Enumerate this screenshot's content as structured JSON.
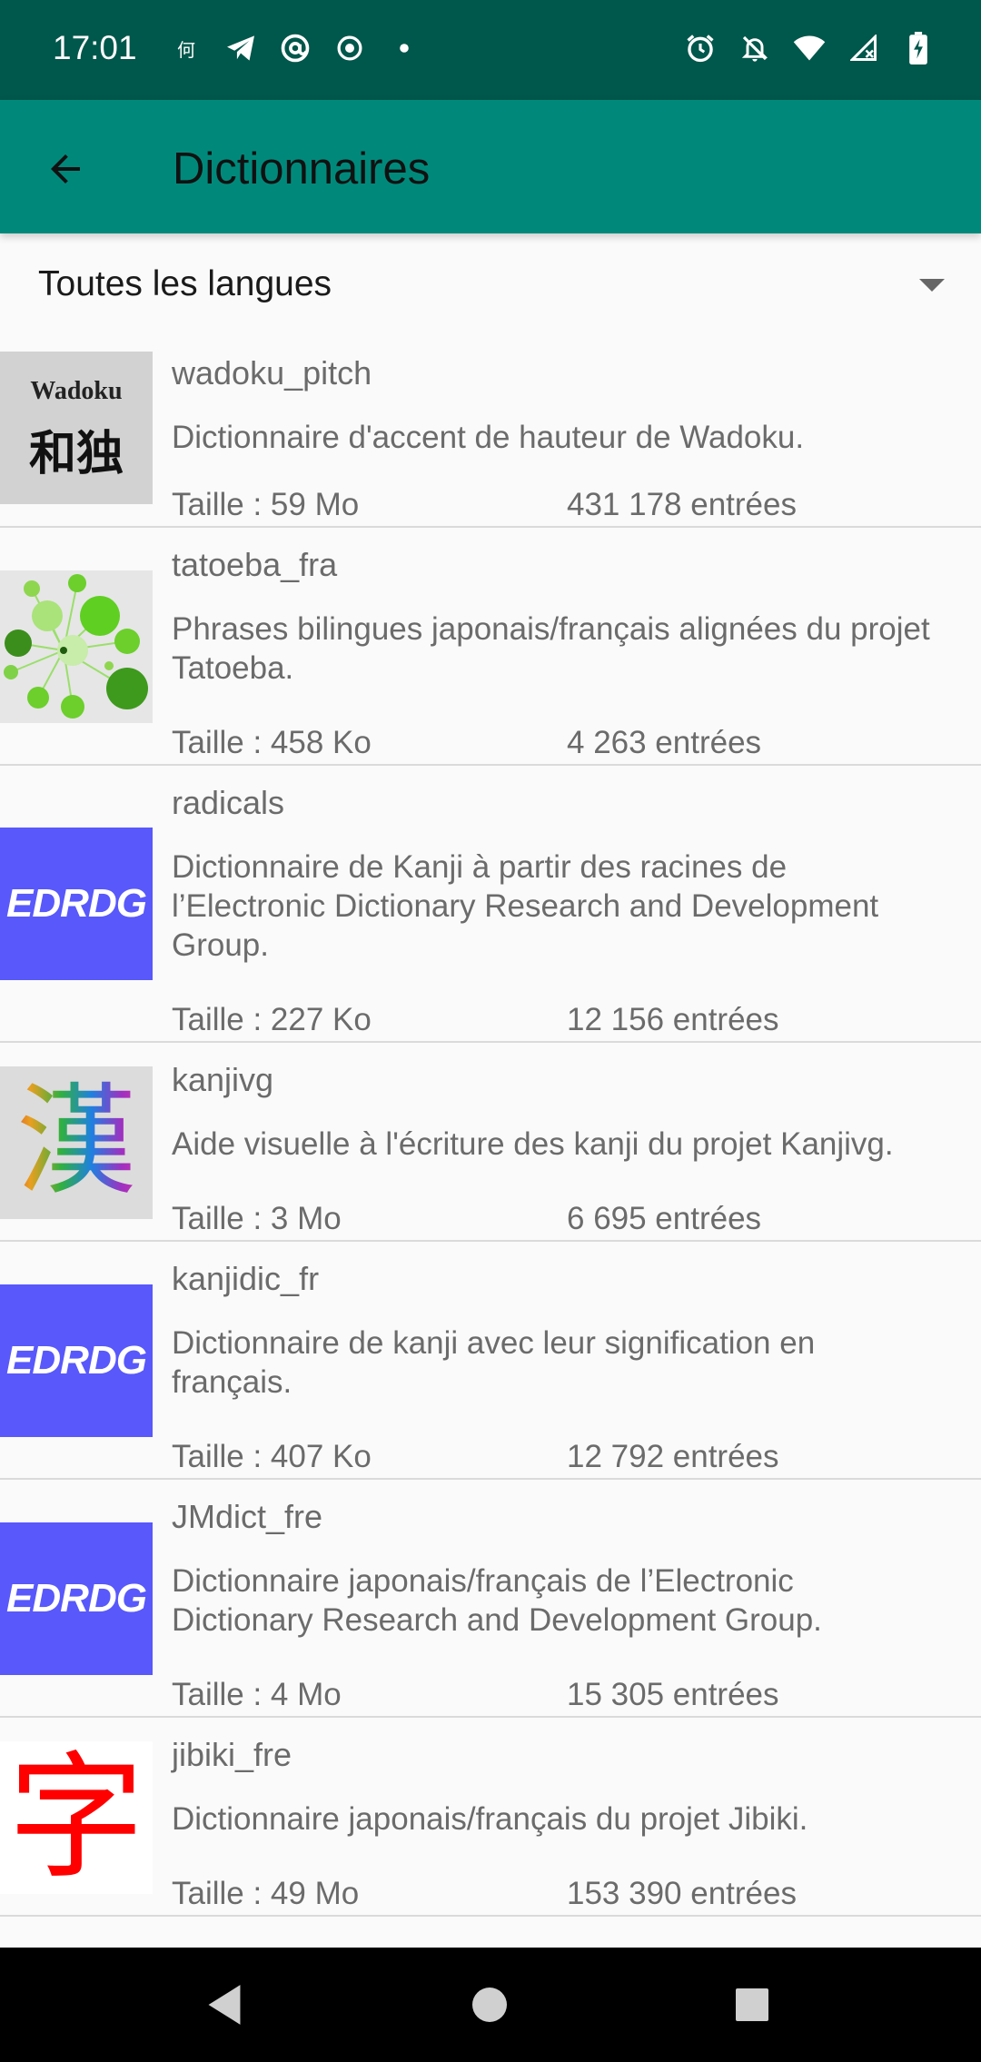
{
  "status_bar": {
    "time": "17:01",
    "left_icons": [
      "chinese-char-notification-icon",
      "telegram-icon",
      "at-sign-icon",
      "record-icon",
      "dot-icon"
    ],
    "right_icons": [
      "alarm-icon",
      "notifications-off-icon",
      "wifi-icon",
      "signal-icon",
      "battery-charging-icon"
    ]
  },
  "app_bar": {
    "title": "Dictionnaires",
    "back_icon": "arrow-back-icon"
  },
  "language_filter": {
    "selected": "Toutes les langues"
  },
  "dictionaries": [
    {
      "name": "wadoku_pitch",
      "description": "Dictionnaire d'accent de hauteur de Wadoku.",
      "size": "Taille : 59 Mo",
      "entries": "431 178 entrées",
      "thumb": "wadoku-logo",
      "thumb_top": "Wadoku",
      "thumb_bottom": "和独"
    },
    {
      "name": "tatoeba_fra",
      "description": "Phrases bilingues japonais/français alignées du projet Tatoeba.",
      "size": "Taille : 458 Ko",
      "entries": "4 263 entrées",
      "thumb": "tatoeba-logo"
    },
    {
      "name": "radicals",
      "description": "Dictionnaire de Kanji à partir des racines de l’Electronic Dictionary Research and Development Group.",
      "size": "Taille : 227 Ko",
      "entries": "12 156 entrées",
      "thumb": "edrdg-logo",
      "thumb_text": "EDRDG"
    },
    {
      "name": "kanjivg",
      "description": "Aide visuelle à l'écriture des kanji du projet Kanjivg.",
      "size": "Taille : 3 Mo",
      "entries": "6 695 entrées",
      "thumb": "kanjivg-logo",
      "thumb_text": "漢"
    },
    {
      "name": "kanjidic_fr",
      "description": "Dictionnaire de kanji avec leur signification en français.",
      "size": "Taille : 407 Ko",
      "entries": "12 792 entrées",
      "thumb": "edrdg-logo",
      "thumb_text": "EDRDG"
    },
    {
      "name": "JMdict_fre",
      "description": "Dictionnaire japonais/français de l’Electronic Dictionary Research and Development Group.",
      "size": "Taille : 4 Mo",
      "entries": "15 305 entrées",
      "thumb": "edrdg-logo",
      "thumb_text": "EDRDG"
    },
    {
      "name": "jibiki_fre",
      "description": "Dictionnaire japonais/français du projet Jibiki.",
      "size": "Taille : 49 Mo",
      "entries": "153 390 entrées",
      "thumb": "jibiki-logo",
      "thumb_text": "字"
    }
  ],
  "colors": {
    "status_bar": "#00574b",
    "app_bar": "#00897b",
    "edrdg": "#5858fb",
    "jibiki_red": "#ff0000"
  },
  "nav_bar": {
    "back": "nav-back-icon",
    "home": "nav-home-icon",
    "recents": "nav-recents-icon"
  }
}
